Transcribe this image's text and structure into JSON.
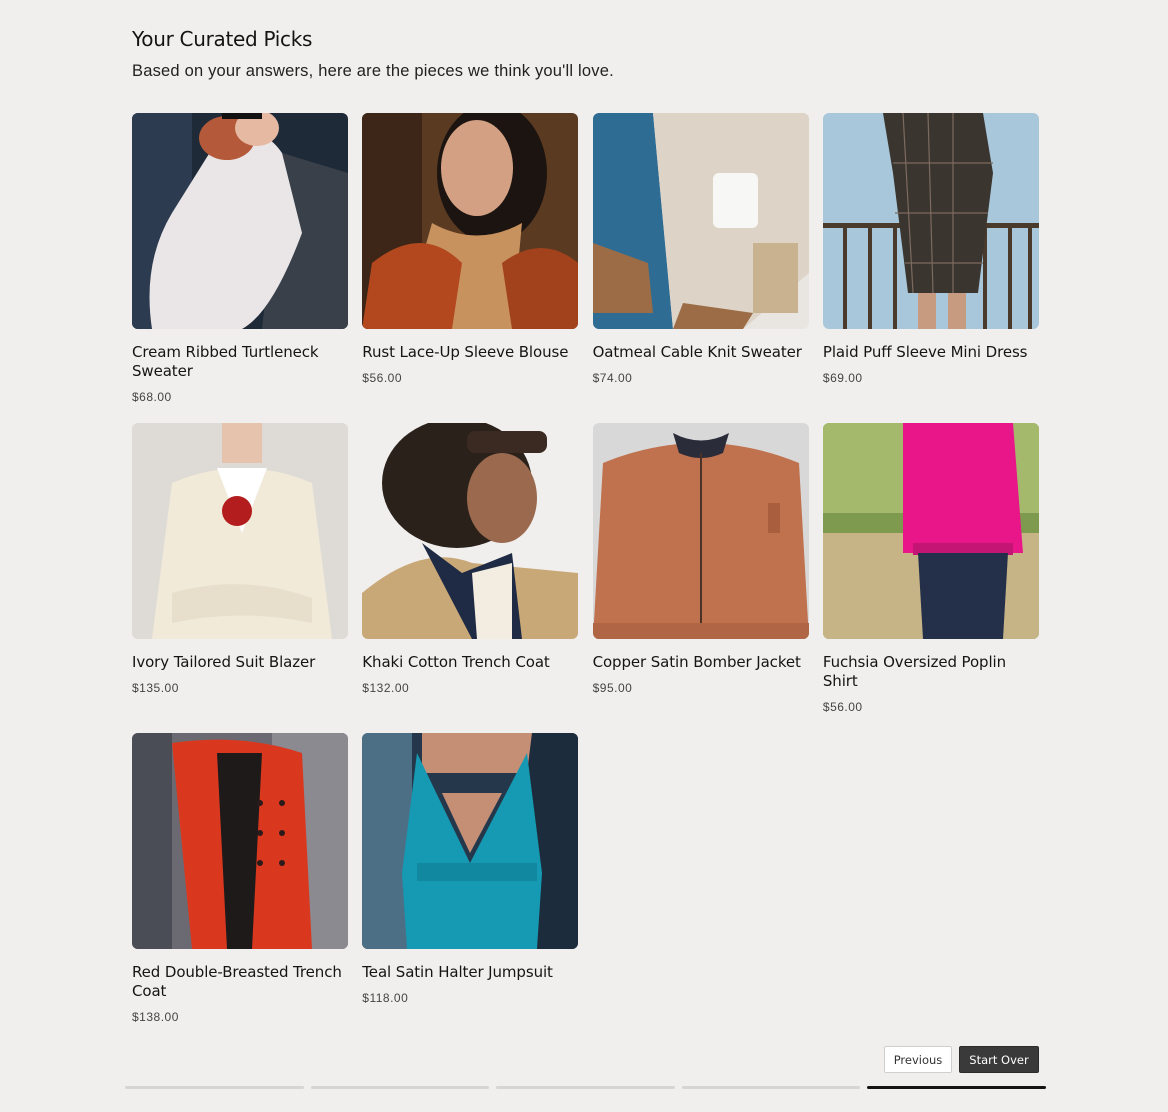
{
  "header": {
    "title": "Your Curated Picks",
    "subtitle": "Based on your answers, here are the pieces we think you'll love."
  },
  "products": [
    {
      "name": "Cream Ribbed Turtleneck Sweater",
      "price": "$68.00",
      "image_icon": "turtleneck-photo"
    },
    {
      "name": "Rust Lace-Up Sleeve Blouse",
      "price": "$56.00",
      "image_icon": "blouse-photo"
    },
    {
      "name": "Oatmeal Cable Knit Sweater",
      "price": "$74.00",
      "image_icon": "sweater-flatlay-photo"
    },
    {
      "name": "Plaid Puff Sleeve Mini Dress",
      "price": "$69.00",
      "image_icon": "dress-photo"
    },
    {
      "name": "Ivory Tailored Suit Blazer",
      "price": "$135.00",
      "image_icon": "blazer-photo"
    },
    {
      "name": "Khaki Cotton Trench Coat",
      "price": "$132.00",
      "image_icon": "trench-photo"
    },
    {
      "name": "Copper Satin Bomber Jacket",
      "price": "$95.00",
      "image_icon": "bomber-photo"
    },
    {
      "name": "Fuchsia Oversized Poplin Shirt",
      "price": "$56.00",
      "image_icon": "poplin-shirt-photo"
    },
    {
      "name": "Red Double-Breasted Trench Coat",
      "price": "$138.00",
      "image_icon": "red-trench-photo"
    },
    {
      "name": "Teal Satin Halter Jumpsuit",
      "price": "$118.00",
      "image_icon": "jumpsuit-photo"
    }
  ],
  "nav": {
    "previous_label": "Previous",
    "start_over_label": "Start Over"
  },
  "progress": {
    "steps": 5,
    "current": 5
  },
  "colors": {
    "background": "#f1efee",
    "primary_button": "#3a3a3a",
    "progress_active": "#141414",
    "progress_inactive": "#d7d5d3"
  }
}
